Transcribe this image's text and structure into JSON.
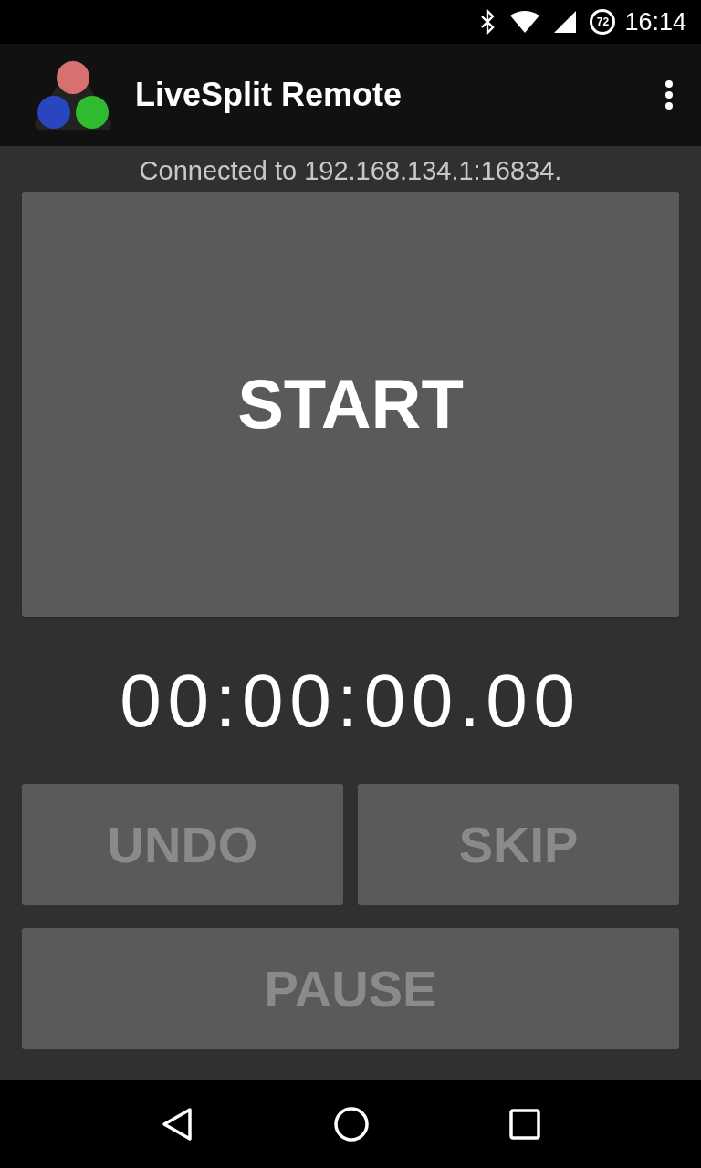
{
  "status_bar": {
    "battery": "72",
    "time": "16:14"
  },
  "app_bar": {
    "title": "LiveSplit Remote"
  },
  "connection": "Connected to 192.168.134.1:16834.",
  "start_button": {
    "label": "START",
    "disabled": false
  },
  "timer": "00:00:00.00",
  "buttons": [
    {
      "label": "UNDO",
      "disabled": true
    },
    {
      "label": "SKIP",
      "disabled": true
    }
  ],
  "pause_button": {
    "label": "PAUSE",
    "disabled": true
  }
}
